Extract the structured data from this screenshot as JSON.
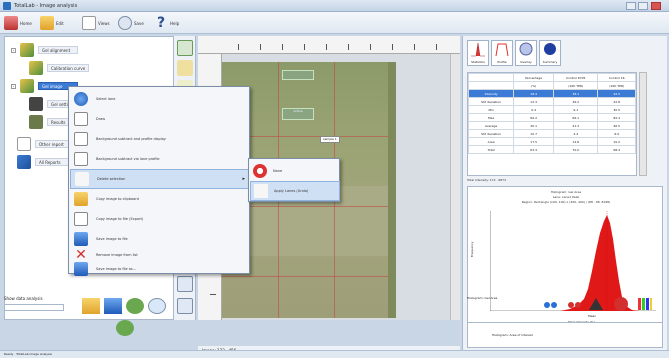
{
  "window": {
    "title": "TotalLab - Image analysis"
  },
  "toolbar": {
    "buttons": [
      {
        "label": "Home",
        "icon": "home-icon"
      },
      {
        "label": "Edit",
        "icon": "folder-icon"
      },
      {
        "label": "Views",
        "icon": "window-icon"
      },
      {
        "label": "Save",
        "icon": "save-icon"
      },
      {
        "label": "Help",
        "icon": "help-icon"
      }
    ]
  },
  "tree": {
    "items": [
      {
        "label": "Gel alignment"
      },
      {
        "label": "Calibration curve"
      },
      {
        "label": "Gel image"
      },
      {
        "label": "Gel settings"
      },
      {
        "label": "Results"
      },
      {
        "label": "Other report"
      },
      {
        "label": "All Reports"
      }
    ]
  },
  "context_menu": {
    "items": [
      {
        "label": "Select lane",
        "icon": "globe-icon"
      },
      {
        "label": "Draw",
        "icon": "pencil-icon"
      },
      {
        "label": "Background subtract and profile display",
        "icon": "chart-icon"
      },
      {
        "label": "Background subtract via lane profile",
        "icon": "curve-icon"
      },
      {
        "label": "Delete selection",
        "icon": "scissors-icon"
      },
      {
        "label": "Copy image to clipboard",
        "icon": "folder-icon"
      },
      {
        "label": "Copy image to file (Export)",
        "icon": "export-icon"
      },
      {
        "label": "Save image to file",
        "icon": "printer-icon"
      },
      {
        "label": "Remove image from list",
        "icon": "delete-icon"
      },
      {
        "label": "Save image to file as...",
        "icon": "save-icon"
      }
    ],
    "submenu": [
      {
        "label": "None",
        "icon": "no-entry-icon"
      },
      {
        "label": "Apply Lanes (Undo)",
        "icon": "lanes-icon"
      }
    ]
  },
  "image_view": {
    "sample_tag": "sample 1",
    "boxes": [
      {
        "label": ""
      },
      {
        "label": "Active"
      }
    ],
    "status": "Image: 123 · 456"
  },
  "right_panel": {
    "tabs": [
      {
        "label": "Statistics",
        "icon": "peak-icon"
      },
      {
        "label": "Profile",
        "icon": "profile-icon"
      },
      {
        "label": "Overlay",
        "icon": "overlay-icon"
      },
      {
        "label": "Summary",
        "icon": "circle-icon"
      }
    ],
    "table": {
      "headers": [
        "",
        "Percentage",
        "Control 6705",
        "Control 16"
      ],
      "subheaders": [
        "",
        "(%)",
        "(10K TPR)",
        "(10K TPR)"
      ],
      "rows": [
        [
          "Intensity",
          "18.4",
          "38.1",
          "42.5"
        ],
        [
          "Std deviation",
          "12.3",
          "36.2",
          "22.8"
        ],
        [
          "Min",
          "0.4",
          "9.1",
          "30.5"
        ],
        [
          "Max",
          "60.2",
          "66.1",
          "82.4"
        ],
        [
          "Average",
          "30.1",
          "41.3",
          "46.5"
        ],
        [
          "Std deviation",
          "10.7",
          "4.4",
          "6.0"
        ],
        [
          "Area",
          "17.5",
          "12.8",
          "15.2"
        ],
        [
          "Total",
          "63.3",
          "70.0",
          "68.4"
        ]
      ],
      "caption": "Total Intensity: 172 · 6873"
    },
    "histogram": {
      "title_lines": [
        "Histogram: Gel Area",
        "Lane: Lane1 Peak",
        "Region: Rectangle (100, 100) x (300, 400) / (88 · 98, 8198)"
      ],
      "ylabel": "Frequency",
      "xlabel": "Pixel intensity (%)",
      "peak_label": "Mean"
    },
    "nav_label": "Histogram: Gel Area",
    "list_item": "Histogram: Area of interest",
    "status": "Image Analysis Active"
  },
  "bottom_left": {
    "label": "Show data analysis"
  },
  "statusbar": {
    "text": "Ready · TotalLab image analysis"
  }
}
